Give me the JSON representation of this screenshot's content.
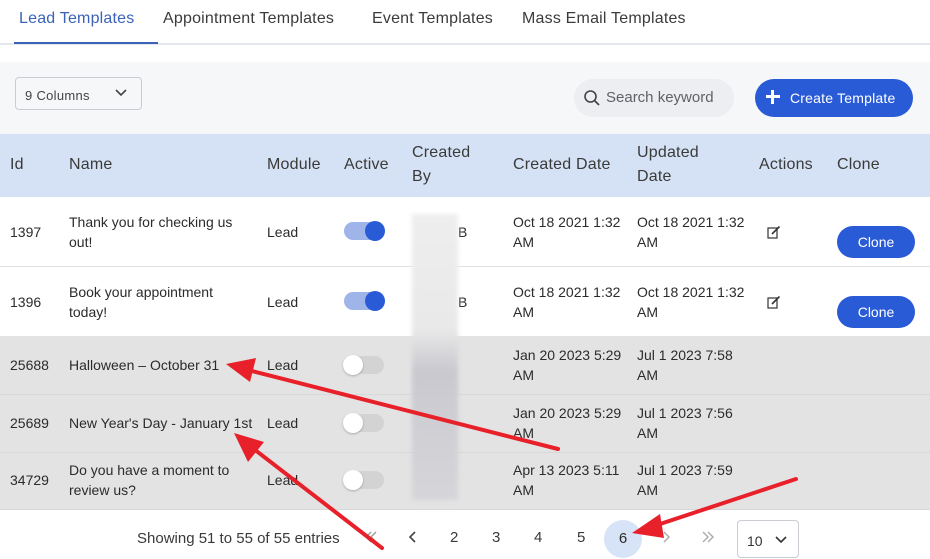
{
  "tabs": [
    {
      "label": "Lead Templates",
      "active": true
    },
    {
      "label": "Appointment Templates",
      "active": false
    },
    {
      "label": "Event Templates",
      "active": false
    },
    {
      "label": "Mass Email Templates",
      "active": false
    }
  ],
  "toolbar": {
    "columns_select": "9 Columns",
    "search_placeholder": "Search keyword",
    "create_label": "Create Template"
  },
  "table": {
    "headers": {
      "id": "Id",
      "name": "Name",
      "module": "Module",
      "active": "Active",
      "created_by_1": "Created",
      "created_by_2": "By",
      "created_date": "Created Date",
      "updated_date_1": "Updated",
      "updated_date_2": "Date",
      "actions": "Actions",
      "clone": "Clone"
    },
    "rows": [
      {
        "id": "1397",
        "name_1": "Thank you for checking us",
        "name_2": "out!",
        "module": "Lead",
        "active": true,
        "created_by": "B",
        "created_1": "Oct 18 2021 1:32",
        "created_2": "AM",
        "updated_1": "Oct 18 2021 1:32",
        "updated_2": "AM",
        "clone_label": "Clone"
      },
      {
        "id": "1396",
        "name_1": "Book your appointment",
        "name_2": "today!",
        "module": "Lead",
        "active": true,
        "created_by": "B",
        "created_1": "Oct 18 2021 1:32",
        "created_2": "AM",
        "updated_1": "Oct 18 2021 1:32",
        "updated_2": "AM",
        "clone_label": "Clone"
      },
      {
        "id": "25688",
        "name_1": "Halloween – October 31",
        "name_2": "",
        "module": "Lead",
        "active": false,
        "created_1": "Jan 20 2023 5:29",
        "created_2": "AM",
        "updated_1": "Jul 1 2023 7:58",
        "updated_2": "AM"
      },
      {
        "id": "25689",
        "name_1": "New Year's Day - January 1st",
        "name_2": "",
        "module": "Lead",
        "active": false,
        "created_1": "Jan 20 2023 5:29",
        "created_2": "AM",
        "updated_1": "Jul 1 2023 7:56",
        "updated_2": "AM"
      },
      {
        "id": "34729",
        "name_1": "Do you have a moment to",
        "name_2": "review us?",
        "module": "Lead",
        "active": false,
        "created_1": "Apr 13 2023 5:11",
        "created_2": "AM",
        "updated_1": "Jul 1 2023 7:59",
        "updated_2": "AM"
      }
    ]
  },
  "pagination": {
    "showing": "Showing 51 to 55 of 55 entries",
    "pages": [
      "2",
      "3",
      "4",
      "5"
    ],
    "current": "6",
    "per_page": "10"
  },
  "colors": {
    "accent": "#2a5bd7",
    "header_bg": "#d5e2f5",
    "tab_active": "#3a63b8",
    "annotation_arrow": "#e8202a"
  }
}
